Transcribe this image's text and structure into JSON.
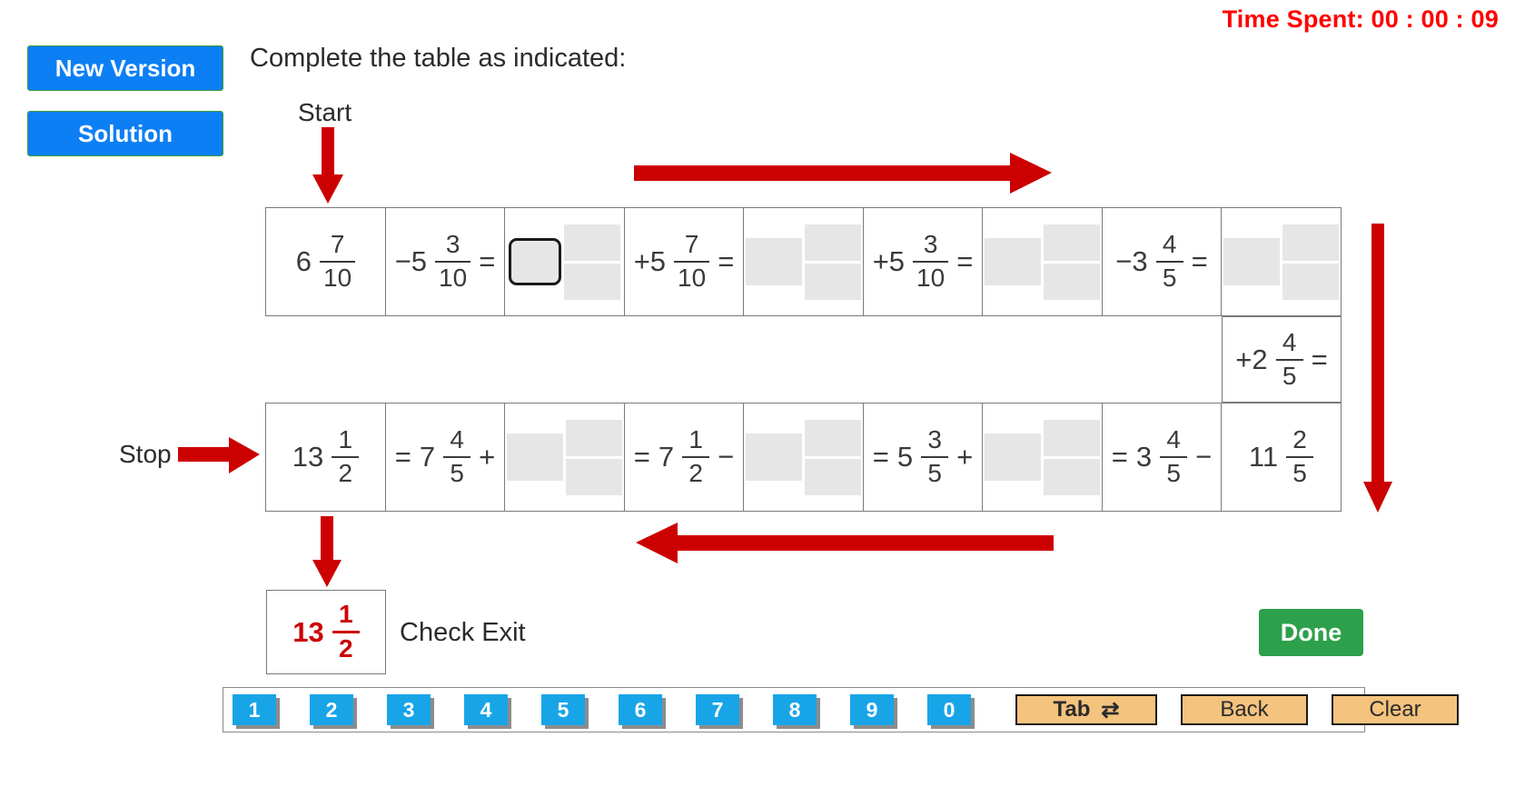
{
  "timer": {
    "label": "Time Spent: 00 : 00 : 09"
  },
  "buttons": {
    "new_version": "New Version",
    "solution": "Solution",
    "done": "Done"
  },
  "prompt": "Complete the table as indicated:",
  "labels": {
    "start": "Start",
    "stop": "Stop",
    "check_exit": "Check Exit"
  },
  "colors": {
    "accent_blue": "#0d7ff5",
    "key_blue": "#18a5e8",
    "arrow_red": "#cc0000",
    "timer_red": "#ff0000",
    "done_green": "#2ca04a",
    "key_orange": "#f4c37d",
    "placeholder_gray": "#e6e6e6"
  },
  "table": {
    "row1": [
      {
        "kind": "value",
        "op": "",
        "whole": "6",
        "num": "7",
        "den": "10",
        "eq": ""
      },
      {
        "kind": "op",
        "op": "−5",
        "whole": "",
        "num": "3",
        "den": "10",
        "eq": "="
      },
      {
        "kind": "answer",
        "active": true
      },
      {
        "kind": "op",
        "op": "+5",
        "whole": "",
        "num": "7",
        "den": "10",
        "eq": "="
      },
      {
        "kind": "answer",
        "active": false
      },
      {
        "kind": "op",
        "op": "+5",
        "whole": "",
        "num": "3",
        "den": "10",
        "eq": "="
      },
      {
        "kind": "answer",
        "active": false
      },
      {
        "kind": "op",
        "op": "−3",
        "whole": "",
        "num": "4",
        "den": "5",
        "eq": "="
      },
      {
        "kind": "answer",
        "active": false
      }
    ],
    "middle": {
      "kind": "op",
      "op": "+2",
      "num": "4",
      "den": "5",
      "eq": "="
    },
    "row2": [
      {
        "kind": "value",
        "pre": "",
        "whole": "13",
        "num": "1",
        "den": "2",
        "post": ""
      },
      {
        "kind": "op",
        "pre": "=",
        "whole": "7",
        "num": "4",
        "den": "5",
        "post": "+"
      },
      {
        "kind": "answer",
        "active": false
      },
      {
        "kind": "op",
        "pre": "=",
        "whole": "7",
        "num": "1",
        "den": "2",
        "post": "−"
      },
      {
        "kind": "answer",
        "active": false
      },
      {
        "kind": "op",
        "pre": "=",
        "whole": "5",
        "num": "3",
        "den": "5",
        "post": "+"
      },
      {
        "kind": "answer",
        "active": false
      },
      {
        "kind": "op",
        "pre": "=",
        "whole": "3",
        "num": "4",
        "den": "5",
        "post": "−"
      },
      {
        "kind": "value",
        "pre": "",
        "whole": "11",
        "num": "2",
        "den": "5",
        "post": ""
      }
    ]
  },
  "exit_answer": {
    "whole": "13",
    "num": "1",
    "den": "2"
  },
  "keypad": {
    "digits": [
      "1",
      "2",
      "3",
      "4",
      "5",
      "6",
      "7",
      "8",
      "9",
      "0"
    ],
    "tab": "Tab",
    "tab_icon": "⇄",
    "back": "Back",
    "clear": "Clear"
  }
}
